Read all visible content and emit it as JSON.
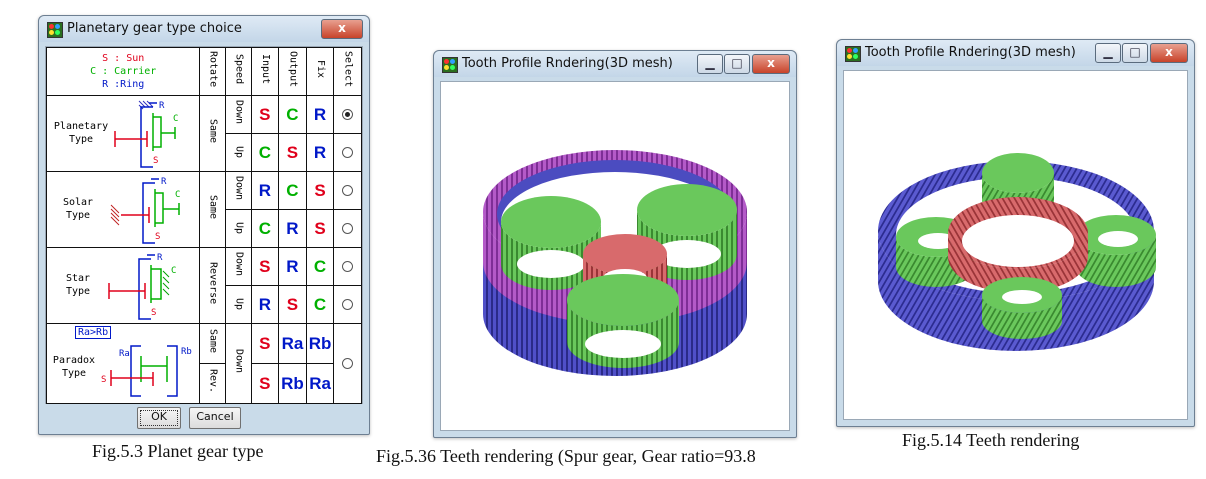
{
  "dialog": {
    "title": "Planetary gear type choice",
    "legend": {
      "sun": "S : Sun",
      "carrier": "C : Carrier",
      "ring": "R :Ring"
    },
    "headers": {
      "rotate": "Rotate",
      "speed": "Speed",
      "input": "Input",
      "output": "Output",
      "fix": "Fix",
      "select": "Select"
    },
    "planetary": {
      "name1": "Planetary",
      "name2": "Type",
      "rotate": "Same",
      "down": "Down",
      "up": "Up",
      "r1": {
        "in": "S",
        "out": "C",
        "fix": "R"
      },
      "r2": {
        "in": "C",
        "out": "S",
        "fix": "R"
      }
    },
    "solar": {
      "name1": "Solar",
      "name2": "Type",
      "rotate": "Same",
      "down": "Down",
      "up": "Up",
      "r1": {
        "in": "R",
        "out": "C",
        "fix": "S"
      },
      "r2": {
        "in": "C",
        "out": "R",
        "fix": "S"
      }
    },
    "star": {
      "name1": "Star",
      "name2": "Type",
      "rotate": "Reverse",
      "down": "Down",
      "up": "Up",
      "r1": {
        "in": "S",
        "out": "R",
        "fix": "C"
      },
      "r2": {
        "in": "R",
        "out": "S",
        "fix": "C"
      }
    },
    "paradox": {
      "name1": "Paradox",
      "name2": "Type",
      "ratio": "Ra>Rb",
      "ra": "Ra",
      "rb": "Rb",
      "s": "S",
      "same": "Same",
      "rev": "Rev.",
      "down": "Down",
      "r1": {
        "in": "S",
        "out": "Ra",
        "fix": "Rb"
      },
      "r2": {
        "in": "S",
        "out": "Rb",
        "fix": "Ra"
      }
    },
    "diagram_labels": {
      "r": "R",
      "c": "C",
      "s": "S"
    },
    "ok": "OK",
    "cancel": "Cancel",
    "close_glyph": "x"
  },
  "window2": {
    "title": "Tooth Profile Rndering(3D mesh)"
  },
  "window3": {
    "title": "Tooth Profile Rndering(3D mesh)"
  },
  "captions": {
    "fig1": "Fig.5.3 Planet gear type",
    "fig2": "Fig.5.36 Teeth rendering (Spur gear, Gear ratio=93.8",
    "fig3": "Fig.5.14 Teeth rendering"
  },
  "colors": {
    "sun_gear": "#cc4f52",
    "planet_gear": "#5ab84e",
    "ring_outer": "#4b4cc0",
    "ring_inner": "#b45ac8"
  }
}
